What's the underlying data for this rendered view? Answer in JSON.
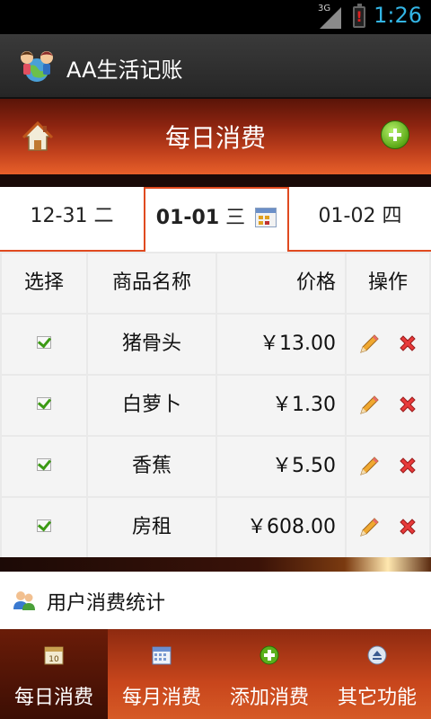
{
  "status_bar": {
    "network": "3G",
    "time": "1:26"
  },
  "app_bar": {
    "title": "AA生活记账"
  },
  "header": {
    "title": "每日消费"
  },
  "date_tabs": {
    "prev": {
      "date": "12-31",
      "weekday": "二"
    },
    "current": {
      "date": "01-01",
      "weekday": "三"
    },
    "next": {
      "date": "01-02",
      "weekday": "四"
    }
  },
  "table": {
    "headers": {
      "select": "选择",
      "name": "商品名称",
      "price": "价格",
      "actions": "操作"
    },
    "rows": [
      {
        "checked": true,
        "name": "猪骨头",
        "price": "￥13.00"
      },
      {
        "checked": true,
        "name": "白萝卜",
        "price": "￥1.30"
      },
      {
        "checked": true,
        "name": "香蕉",
        "price": "￥5.50"
      },
      {
        "checked": true,
        "name": "房租",
        "price": "￥608.00"
      }
    ]
  },
  "stats_link": {
    "label": "用户消费统计"
  },
  "bottom_nav": [
    {
      "label": "每日消费",
      "icon": "daily-calendar-icon",
      "active": true
    },
    {
      "label": "每月消费",
      "icon": "monthly-calendar-icon",
      "active": false
    },
    {
      "label": "添加消费",
      "icon": "add-circle-icon",
      "active": false
    },
    {
      "label": "其它功能",
      "icon": "eject-circle-icon",
      "active": false
    }
  ],
  "colors": {
    "accent": "#e04a20",
    "time": "#33b5e5",
    "header_top": "#5a1408",
    "header_bottom": "#e8602a"
  }
}
